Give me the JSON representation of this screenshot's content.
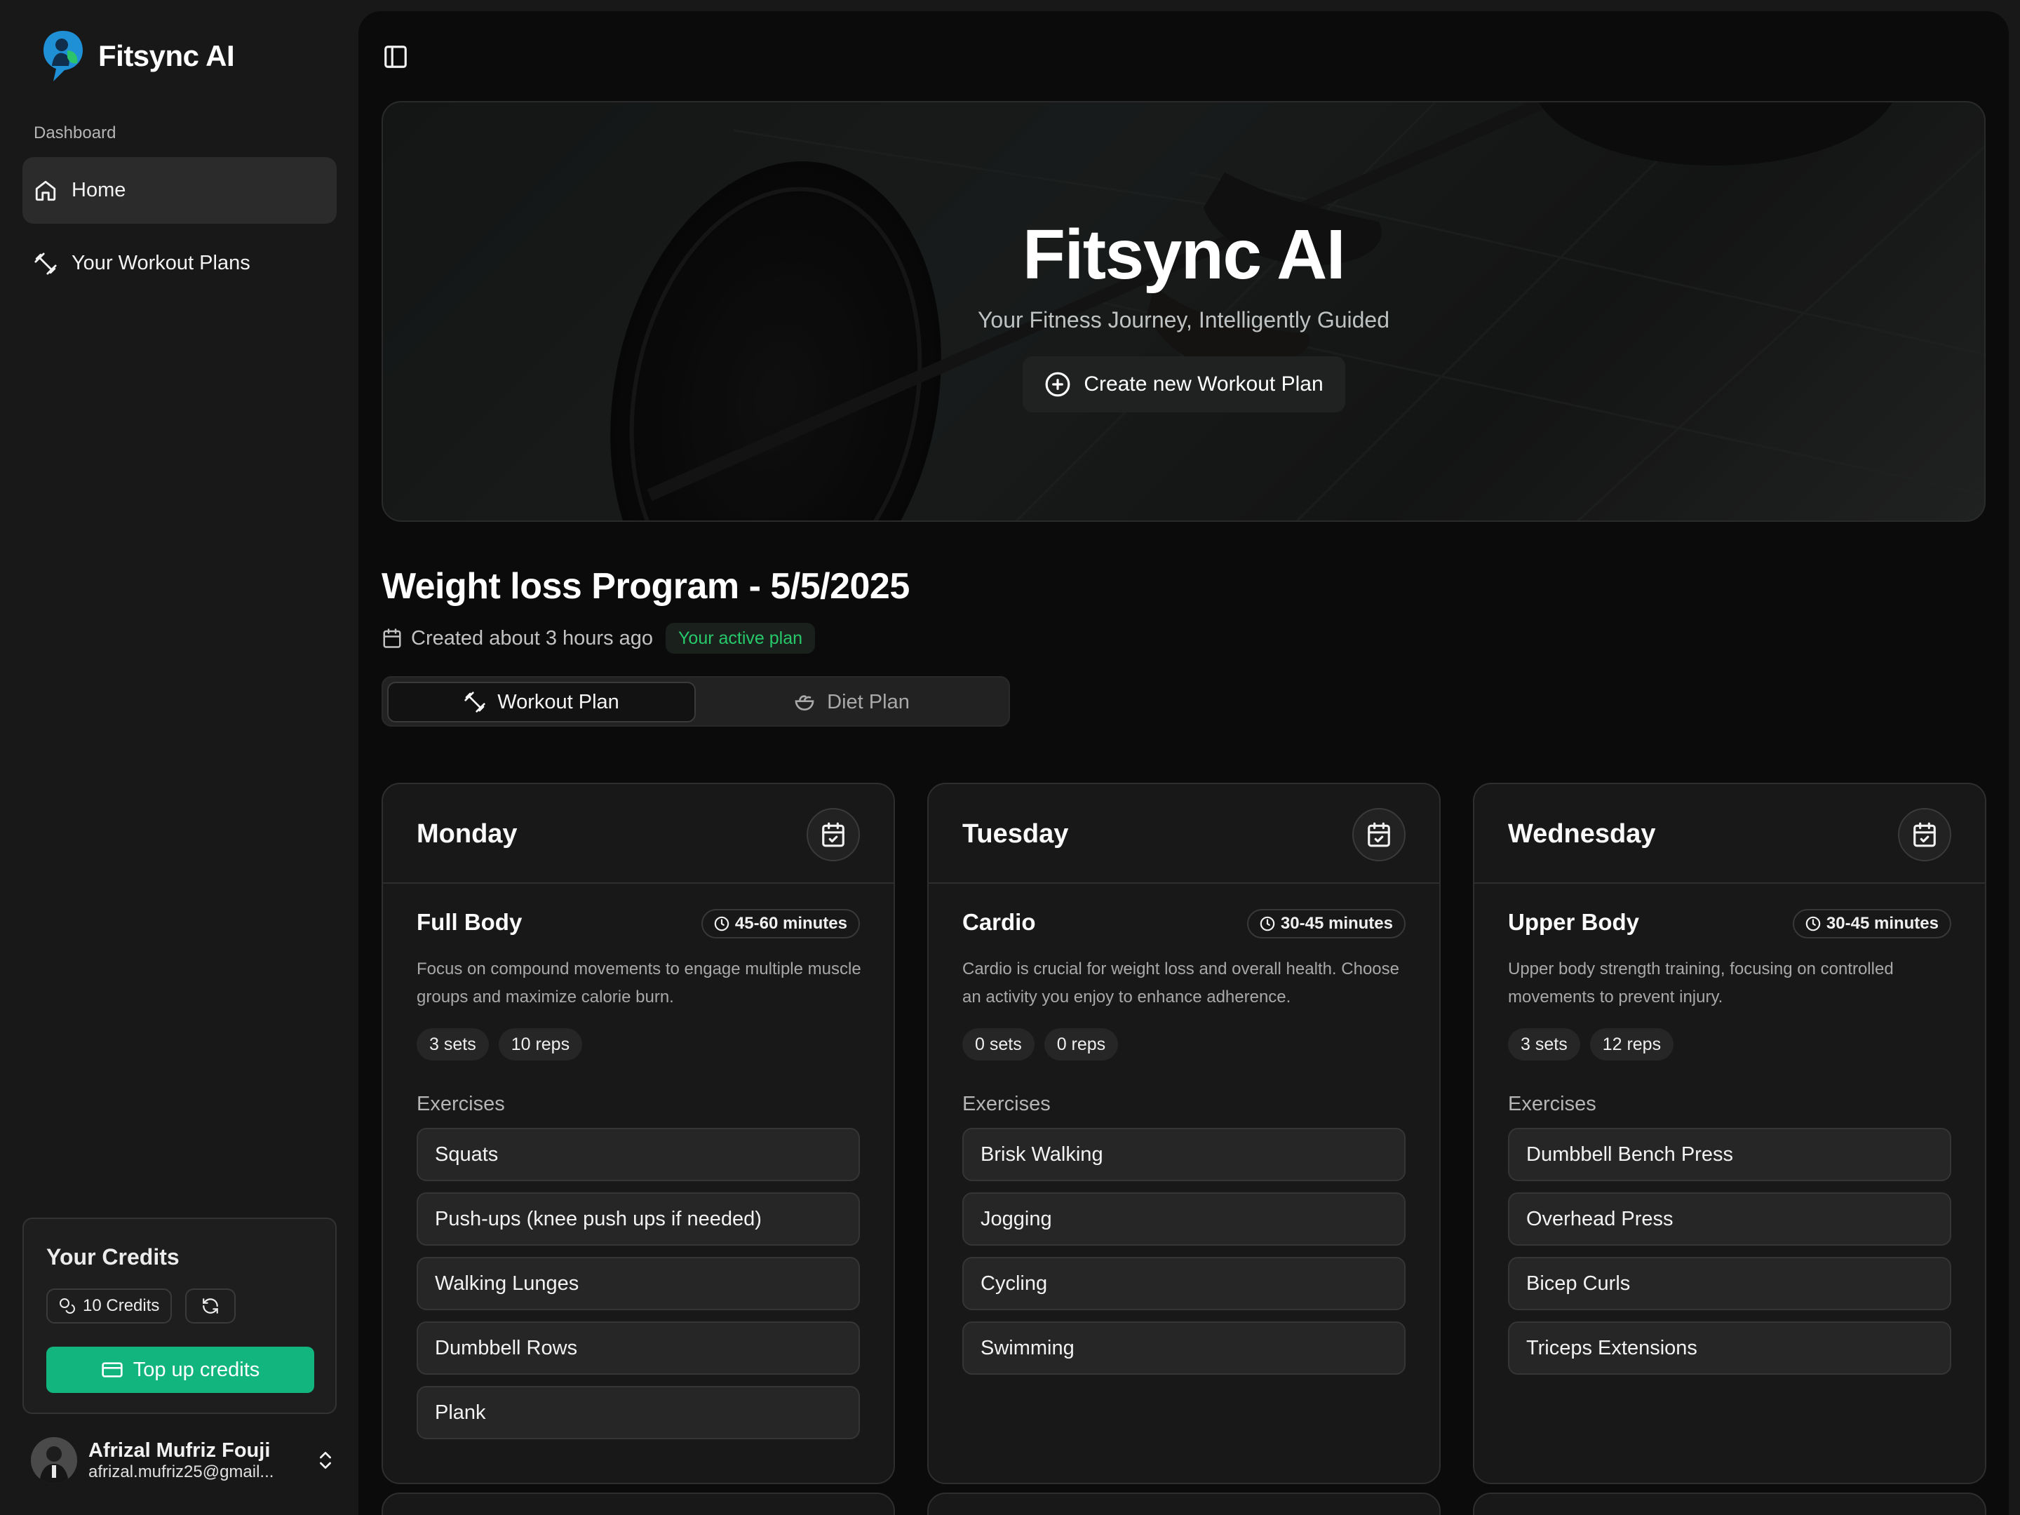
{
  "app": {
    "name": "Fitsync AI",
    "accent_color": "#13b57e"
  },
  "sidebar": {
    "section_label": "Dashboard",
    "items": [
      {
        "label": "Home",
        "icon": "home-icon",
        "active": true
      },
      {
        "label": "Your Workout Plans",
        "icon": "dumbbell-icon",
        "active": false
      }
    ],
    "credits": {
      "title": "Your Credits",
      "badge": "10 Credits",
      "topup_label": "Top up credits"
    },
    "user": {
      "name": "Afrizal Mufriz Fouji",
      "email": "afrizal.mufriz25@gmail..."
    }
  },
  "hero": {
    "title": "Fitsync AI",
    "subtitle": "Your Fitness Journey, Intelligently Guided",
    "cta_label": "Create new Workout Plan"
  },
  "program": {
    "title": "Weight loss Program - 5/5/2025",
    "created": "Created about 3 hours ago",
    "active_badge": "Your active plan",
    "tabs": [
      {
        "label": "Workout Plan",
        "active": true
      },
      {
        "label": "Diet Plan",
        "active": false
      }
    ]
  },
  "days": [
    {
      "day": "Monday",
      "title": "Full Body",
      "duration": "45-60 minutes",
      "description": "Focus on compound movements to engage multiple muscle groups and maximize calorie burn.",
      "sets": "3 sets",
      "reps": "10 reps",
      "exercises_heading": "Exercises",
      "exercises": [
        "Squats",
        "Push-ups (knee push ups if needed)",
        "Walking Lunges",
        "Dumbbell Rows",
        "Plank"
      ]
    },
    {
      "day": "Tuesday",
      "title": "Cardio",
      "duration": "30-45 minutes",
      "description": "Cardio is crucial for weight loss and overall health. Choose an activity you enjoy to enhance adherence.",
      "sets": "0 sets",
      "reps": "0 reps",
      "exercises_heading": "Exercises",
      "exercises": [
        "Brisk Walking",
        "Jogging",
        "Cycling",
        "Swimming"
      ]
    },
    {
      "day": "Wednesday",
      "title": "Upper Body",
      "duration": "30-45 minutes",
      "description": "Upper body strength training, focusing on controlled movements to prevent injury.",
      "sets": "3 sets",
      "reps": "12 reps",
      "exercises_heading": "Exercises",
      "exercises": [
        "Dumbbell Bench Press",
        "Overhead Press",
        "Bicep Curls",
        "Triceps Extensions"
      ]
    }
  ]
}
